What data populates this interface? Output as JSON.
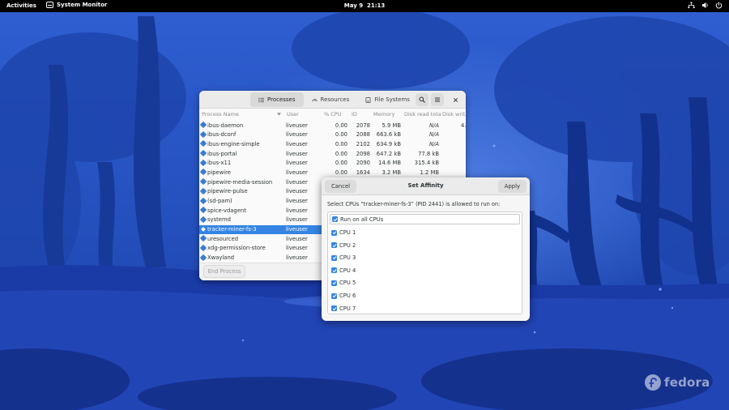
{
  "topbar": {
    "activities": "Activities",
    "app_name": "System Monitor",
    "clock": "May 9  21:13",
    "tray_icons": [
      "network-icon",
      "volume-icon",
      "power-icon"
    ]
  },
  "sysmon": {
    "tabs": [
      {
        "label": "Processes",
        "icon": "list-icon",
        "active": true
      },
      {
        "label": "Resources",
        "icon": "gauge-icon",
        "active": false
      },
      {
        "label": "File Systems",
        "icon": "disk-icon",
        "active": false
      }
    ],
    "columns": {
      "name": "Process Name",
      "user": "User",
      "cpu": "% CPU",
      "id": "ID",
      "memory": "Memory",
      "disk_read": "Disk read tota",
      "disk_write": "Disk writ"
    },
    "processes": [
      {
        "name": "ibus-daemon",
        "user": "liveuser",
        "cpu": "0.00",
        "id": "2078",
        "memory": "5.9 MB",
        "disk_read": "N/A",
        "disk_write": "4."
      },
      {
        "name": "ibus-dconf",
        "user": "liveuser",
        "cpu": "0.00",
        "id": "2088",
        "memory": "663.6 kB",
        "disk_read": "N/A",
        "disk_write": ""
      },
      {
        "name": "ibus-engine-simple",
        "user": "liveuser",
        "cpu": "0.00",
        "id": "2102",
        "memory": "634.9 kB",
        "disk_read": "N/A",
        "disk_write": ""
      },
      {
        "name": "ibus-portal",
        "user": "liveuser",
        "cpu": "0.00",
        "id": "2098",
        "memory": "647.2 kB",
        "disk_read": "77.8 kB",
        "disk_write": ""
      },
      {
        "name": "ibus-x11",
        "user": "liveuser",
        "cpu": "0.00",
        "id": "2090",
        "memory": "14.6 MB",
        "disk_read": "315.4 kB",
        "disk_write": ""
      },
      {
        "name": "pipewire",
        "user": "liveuser",
        "cpu": "0.00",
        "id": "1634",
        "memory": "3.2 MB",
        "disk_read": "1.2 MB",
        "disk_write": ""
      },
      {
        "name": "pipewire-media-session",
        "user": "liveuser",
        "cpu": "",
        "id": "",
        "memory": "",
        "disk_read": "",
        "disk_write": ""
      },
      {
        "name": "pipewire-pulse",
        "user": "liveuser",
        "cpu": "",
        "id": "",
        "memory": "",
        "disk_read": "",
        "disk_write": ""
      },
      {
        "name": "(sd-pam)",
        "user": "liveuser",
        "cpu": "",
        "id": "",
        "memory": "",
        "disk_read": "",
        "disk_write": ""
      },
      {
        "name": "spice-vdagent",
        "user": "liveuser",
        "cpu": "",
        "id": "",
        "memory": "",
        "disk_read": "",
        "disk_write": ""
      },
      {
        "name": "systemd",
        "user": "liveuser",
        "cpu": "",
        "id": "",
        "memory": "",
        "disk_read": "",
        "disk_write": ""
      },
      {
        "name": "tracker-miner-fs-3",
        "user": "liveuser",
        "cpu": "",
        "id": "",
        "memory": "",
        "disk_read": "",
        "disk_write": "",
        "selected": true
      },
      {
        "name": "uresourced",
        "user": "liveuser",
        "cpu": "",
        "id": "",
        "memory": "",
        "disk_read": "",
        "disk_write": ""
      },
      {
        "name": "xdg-permission-store",
        "user": "liveuser",
        "cpu": "",
        "id": "",
        "memory": "",
        "disk_read": "",
        "disk_write": ""
      },
      {
        "name": "Xwayland",
        "user": "liveuser",
        "cpu": "",
        "id": "",
        "memory": "",
        "disk_read": "",
        "disk_write": ""
      }
    ],
    "end_process_label": "End Process"
  },
  "affinity": {
    "cancel_label": "Cancel",
    "title": "Set Affinity",
    "apply_label": "Apply",
    "prompt": "Select CPUs “tracker-miner-fs-3” (PID 2441) is allowed to run on:",
    "options": [
      {
        "label": "Run on all CPUs",
        "checked": true
      },
      {
        "label": "CPU 1",
        "checked": true
      },
      {
        "label": "CPU 2",
        "checked": true
      },
      {
        "label": "CPU 3",
        "checked": true
      },
      {
        "label": "CPU 4",
        "checked": true
      },
      {
        "label": "CPU 5",
        "checked": true
      },
      {
        "label": "CPU 6",
        "checked": true
      },
      {
        "label": "CPU 7",
        "checked": true
      }
    ]
  },
  "branding": {
    "logo_text": "fedora"
  },
  "colors": {
    "accent": "#3584e4",
    "topbar": "#000000",
    "wallpaper_sky": "#2a55c8",
    "wallpaper_deep": "#0f2a78"
  }
}
